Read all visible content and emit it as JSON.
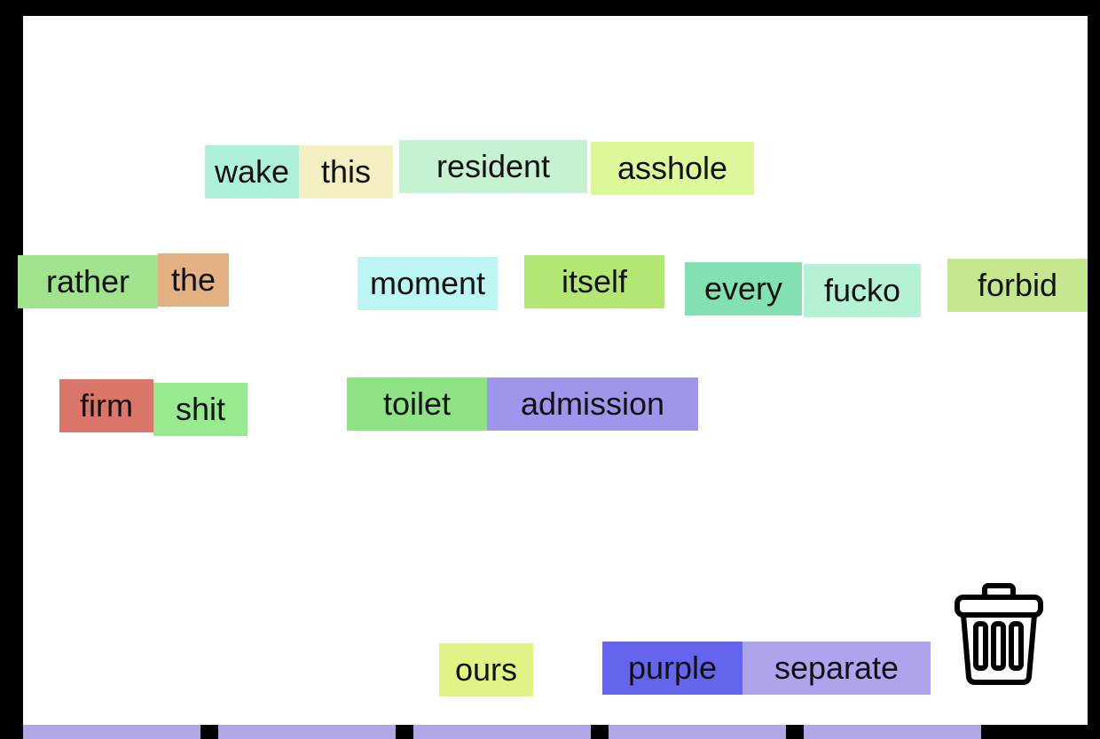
{
  "words": [
    {
      "id": "wake",
      "text": "wake",
      "color": "#aef0d8"
    },
    {
      "id": "this",
      "text": "this",
      "color": "#f4eec3"
    },
    {
      "id": "resident",
      "text": "resident",
      "color": "#c6f2d2"
    },
    {
      "id": "asshole",
      "text": "asshole",
      "color": "#def79a"
    },
    {
      "id": "rather",
      "text": "rather",
      "color": "#a0e28e"
    },
    {
      "id": "the",
      "text": "the",
      "color": "#e2b083"
    },
    {
      "id": "moment",
      "text": "moment",
      "color": "#bdf4f4"
    },
    {
      "id": "itself",
      "text": "itself",
      "color": "#b3e675"
    },
    {
      "id": "every",
      "text": "every",
      "color": "#83e0b0"
    },
    {
      "id": "fucko",
      "text": "fucko",
      "color": "#b5f2d5"
    },
    {
      "id": "forbid",
      "text": "forbid",
      "color": "#c3e68f"
    },
    {
      "id": "firm",
      "text": "firm",
      "color": "#da7569"
    },
    {
      "id": "shit",
      "text": "shit",
      "color": "#97ea8f"
    },
    {
      "id": "toilet",
      "text": "toilet",
      "color": "#8ee485"
    },
    {
      "id": "admission",
      "text": "admission",
      "color": "#9e96ea"
    },
    {
      "id": "ours",
      "text": "ours",
      "color": "#def486"
    },
    {
      "id": "purple",
      "text": "purple",
      "color": "#6464ec"
    },
    {
      "id": "separate",
      "text": "separate",
      "color": "#aea4ee"
    }
  ],
  "trash": {
    "icon": "trash-can-icon"
  },
  "tray": {
    "slot_color": "#b4a6e6",
    "slots": 5
  }
}
